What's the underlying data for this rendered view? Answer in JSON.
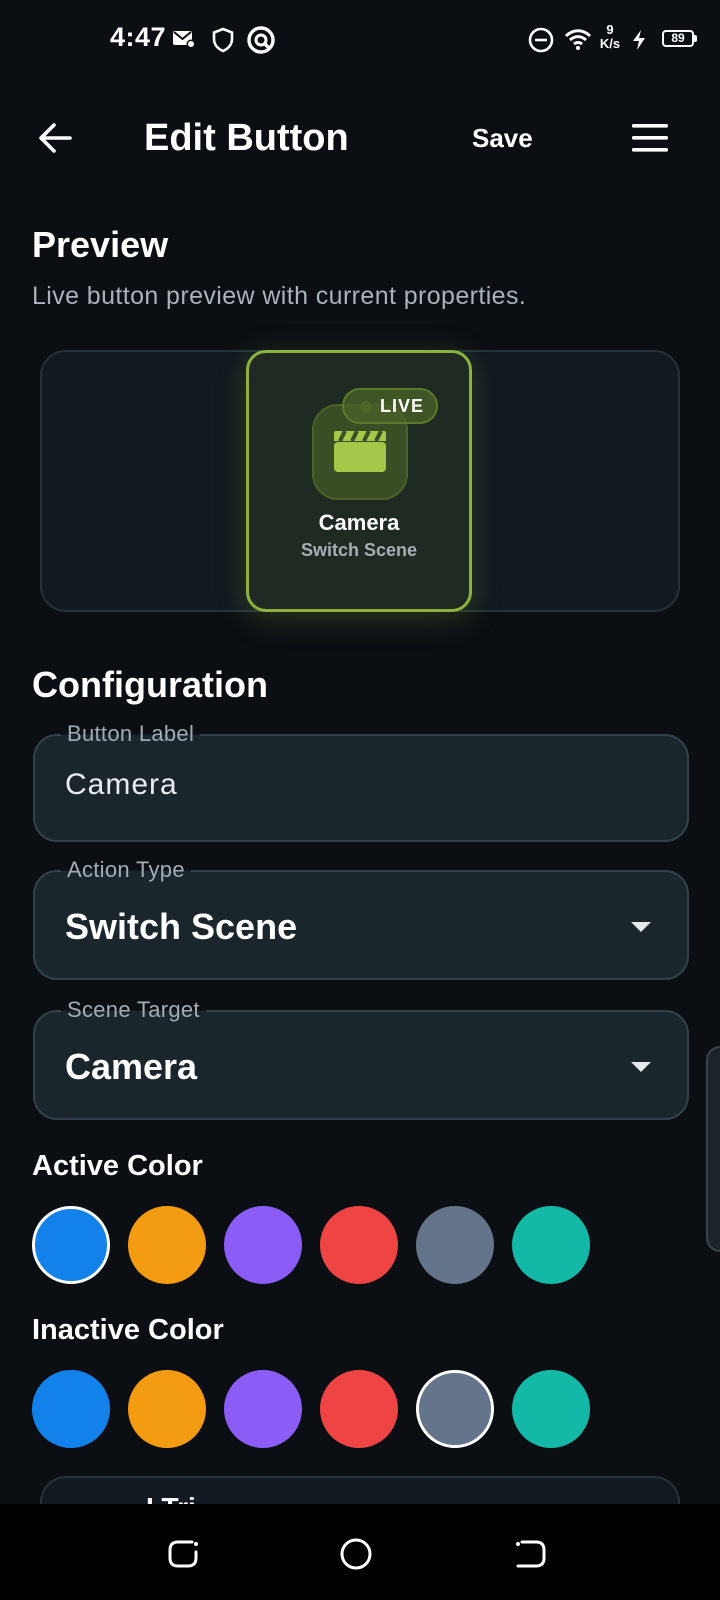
{
  "status_bar": {
    "time": "4:47",
    "net_speed_value": "9",
    "net_speed_unit": "K/s",
    "battery": "89",
    "icons": [
      "mail-settings-icon",
      "shield-icon",
      "circle-app-icon",
      "do-not-disturb-icon",
      "wifi-icon",
      "charging-icon",
      "battery-icon"
    ]
  },
  "app_bar": {
    "title": "Edit Button",
    "save_label": "Save",
    "back_icon": "arrow-left-icon",
    "menu_icon": "menu-icon"
  },
  "preview": {
    "title": "Preview",
    "subtitle": "Live button preview with current properties.",
    "badge": "LIVE",
    "card_label": "Camera",
    "card_action": "Switch Scene",
    "card_icon": "clapperboard-icon",
    "accent_color": "#8fb03d"
  },
  "configuration": {
    "title": "Configuration",
    "button_label": {
      "label": "Button Label",
      "value": "Camera"
    },
    "action_type": {
      "label": "Action Type",
      "value": "Switch Scene"
    },
    "scene_target": {
      "label": "Scene Target",
      "value": "Camera"
    }
  },
  "active_color": {
    "title": "Active Color",
    "swatches": [
      "#1282ea",
      "#f39c12",
      "#8b5cf6",
      "#ef4444",
      "#64748b",
      "#14b8a6"
    ],
    "selected_index": 0
  },
  "inactive_color": {
    "title": "Inactive Color",
    "swatches": [
      "#1282ea",
      "#f39c12",
      "#8b5cf6",
      "#ef4444",
      "#64748b",
      "#14b8a6"
    ],
    "selected_index": 4
  },
  "partial_card": {
    "text": "I       Tri"
  },
  "nav_bar": {
    "buttons": [
      "recents-icon",
      "home-icon",
      "back-icon"
    ]
  }
}
